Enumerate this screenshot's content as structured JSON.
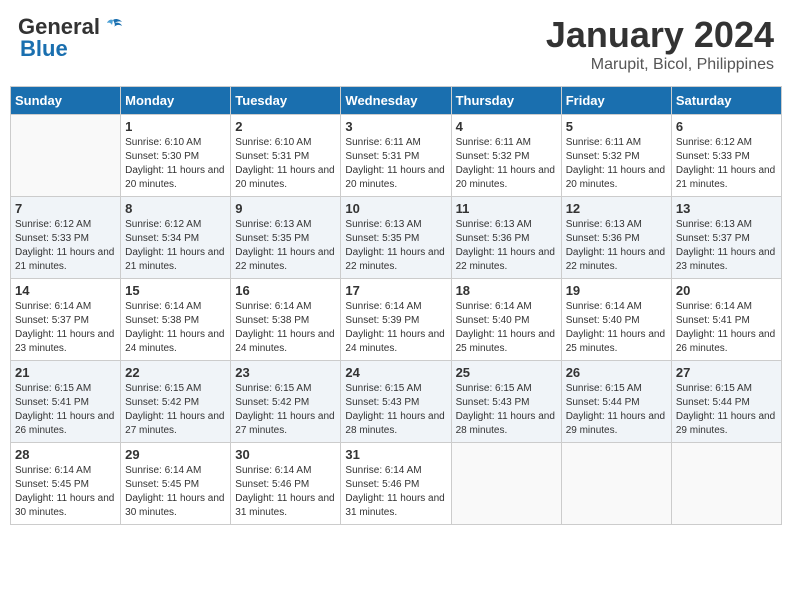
{
  "header": {
    "logo_line1": "General",
    "logo_line2": "Blue",
    "month_title": "January 2024",
    "location": "Marupit, Bicol, Philippines"
  },
  "weekdays": [
    "Sunday",
    "Monday",
    "Tuesday",
    "Wednesday",
    "Thursday",
    "Friday",
    "Saturday"
  ],
  "weeks": [
    [
      {
        "day": "",
        "sunrise": "",
        "sunset": "",
        "daylight": ""
      },
      {
        "day": "1",
        "sunrise": "Sunrise: 6:10 AM",
        "sunset": "Sunset: 5:30 PM",
        "daylight": "Daylight: 11 hours and 20 minutes."
      },
      {
        "day": "2",
        "sunrise": "Sunrise: 6:10 AM",
        "sunset": "Sunset: 5:31 PM",
        "daylight": "Daylight: 11 hours and 20 minutes."
      },
      {
        "day": "3",
        "sunrise": "Sunrise: 6:11 AM",
        "sunset": "Sunset: 5:31 PM",
        "daylight": "Daylight: 11 hours and 20 minutes."
      },
      {
        "day": "4",
        "sunrise": "Sunrise: 6:11 AM",
        "sunset": "Sunset: 5:32 PM",
        "daylight": "Daylight: 11 hours and 20 minutes."
      },
      {
        "day": "5",
        "sunrise": "Sunrise: 6:11 AM",
        "sunset": "Sunset: 5:32 PM",
        "daylight": "Daylight: 11 hours and 20 minutes."
      },
      {
        "day": "6",
        "sunrise": "Sunrise: 6:12 AM",
        "sunset": "Sunset: 5:33 PM",
        "daylight": "Daylight: 11 hours and 21 minutes."
      }
    ],
    [
      {
        "day": "7",
        "sunrise": "Sunrise: 6:12 AM",
        "sunset": "Sunset: 5:33 PM",
        "daylight": "Daylight: 11 hours and 21 minutes."
      },
      {
        "day": "8",
        "sunrise": "Sunrise: 6:12 AM",
        "sunset": "Sunset: 5:34 PM",
        "daylight": "Daylight: 11 hours and 21 minutes."
      },
      {
        "day": "9",
        "sunrise": "Sunrise: 6:13 AM",
        "sunset": "Sunset: 5:35 PM",
        "daylight": "Daylight: 11 hours and 22 minutes."
      },
      {
        "day": "10",
        "sunrise": "Sunrise: 6:13 AM",
        "sunset": "Sunset: 5:35 PM",
        "daylight": "Daylight: 11 hours and 22 minutes."
      },
      {
        "day": "11",
        "sunrise": "Sunrise: 6:13 AM",
        "sunset": "Sunset: 5:36 PM",
        "daylight": "Daylight: 11 hours and 22 minutes."
      },
      {
        "day": "12",
        "sunrise": "Sunrise: 6:13 AM",
        "sunset": "Sunset: 5:36 PM",
        "daylight": "Daylight: 11 hours and 22 minutes."
      },
      {
        "day": "13",
        "sunrise": "Sunrise: 6:13 AM",
        "sunset": "Sunset: 5:37 PM",
        "daylight": "Daylight: 11 hours and 23 minutes."
      }
    ],
    [
      {
        "day": "14",
        "sunrise": "Sunrise: 6:14 AM",
        "sunset": "Sunset: 5:37 PM",
        "daylight": "Daylight: 11 hours and 23 minutes."
      },
      {
        "day": "15",
        "sunrise": "Sunrise: 6:14 AM",
        "sunset": "Sunset: 5:38 PM",
        "daylight": "Daylight: 11 hours and 24 minutes."
      },
      {
        "day": "16",
        "sunrise": "Sunrise: 6:14 AM",
        "sunset": "Sunset: 5:38 PM",
        "daylight": "Daylight: 11 hours and 24 minutes."
      },
      {
        "day": "17",
        "sunrise": "Sunrise: 6:14 AM",
        "sunset": "Sunset: 5:39 PM",
        "daylight": "Daylight: 11 hours and 24 minutes."
      },
      {
        "day": "18",
        "sunrise": "Sunrise: 6:14 AM",
        "sunset": "Sunset: 5:40 PM",
        "daylight": "Daylight: 11 hours and 25 minutes."
      },
      {
        "day": "19",
        "sunrise": "Sunrise: 6:14 AM",
        "sunset": "Sunset: 5:40 PM",
        "daylight": "Daylight: 11 hours and 25 minutes."
      },
      {
        "day": "20",
        "sunrise": "Sunrise: 6:14 AM",
        "sunset": "Sunset: 5:41 PM",
        "daylight": "Daylight: 11 hours and 26 minutes."
      }
    ],
    [
      {
        "day": "21",
        "sunrise": "Sunrise: 6:15 AM",
        "sunset": "Sunset: 5:41 PM",
        "daylight": "Daylight: 11 hours and 26 minutes."
      },
      {
        "day": "22",
        "sunrise": "Sunrise: 6:15 AM",
        "sunset": "Sunset: 5:42 PM",
        "daylight": "Daylight: 11 hours and 27 minutes."
      },
      {
        "day": "23",
        "sunrise": "Sunrise: 6:15 AM",
        "sunset": "Sunset: 5:42 PM",
        "daylight": "Daylight: 11 hours and 27 minutes."
      },
      {
        "day": "24",
        "sunrise": "Sunrise: 6:15 AM",
        "sunset": "Sunset: 5:43 PM",
        "daylight": "Daylight: 11 hours and 28 minutes."
      },
      {
        "day": "25",
        "sunrise": "Sunrise: 6:15 AM",
        "sunset": "Sunset: 5:43 PM",
        "daylight": "Daylight: 11 hours and 28 minutes."
      },
      {
        "day": "26",
        "sunrise": "Sunrise: 6:15 AM",
        "sunset": "Sunset: 5:44 PM",
        "daylight": "Daylight: 11 hours and 29 minutes."
      },
      {
        "day": "27",
        "sunrise": "Sunrise: 6:15 AM",
        "sunset": "Sunset: 5:44 PM",
        "daylight": "Daylight: 11 hours and 29 minutes."
      }
    ],
    [
      {
        "day": "28",
        "sunrise": "Sunrise: 6:14 AM",
        "sunset": "Sunset: 5:45 PM",
        "daylight": "Daylight: 11 hours and 30 minutes."
      },
      {
        "day": "29",
        "sunrise": "Sunrise: 6:14 AM",
        "sunset": "Sunset: 5:45 PM",
        "daylight": "Daylight: 11 hours and 30 minutes."
      },
      {
        "day": "30",
        "sunrise": "Sunrise: 6:14 AM",
        "sunset": "Sunset: 5:46 PM",
        "daylight": "Daylight: 11 hours and 31 minutes."
      },
      {
        "day": "31",
        "sunrise": "Sunrise: 6:14 AM",
        "sunset": "Sunset: 5:46 PM",
        "daylight": "Daylight: 11 hours and 31 minutes."
      },
      {
        "day": "",
        "sunrise": "",
        "sunset": "",
        "daylight": ""
      },
      {
        "day": "",
        "sunrise": "",
        "sunset": "",
        "daylight": ""
      },
      {
        "day": "",
        "sunrise": "",
        "sunset": "",
        "daylight": ""
      }
    ]
  ]
}
